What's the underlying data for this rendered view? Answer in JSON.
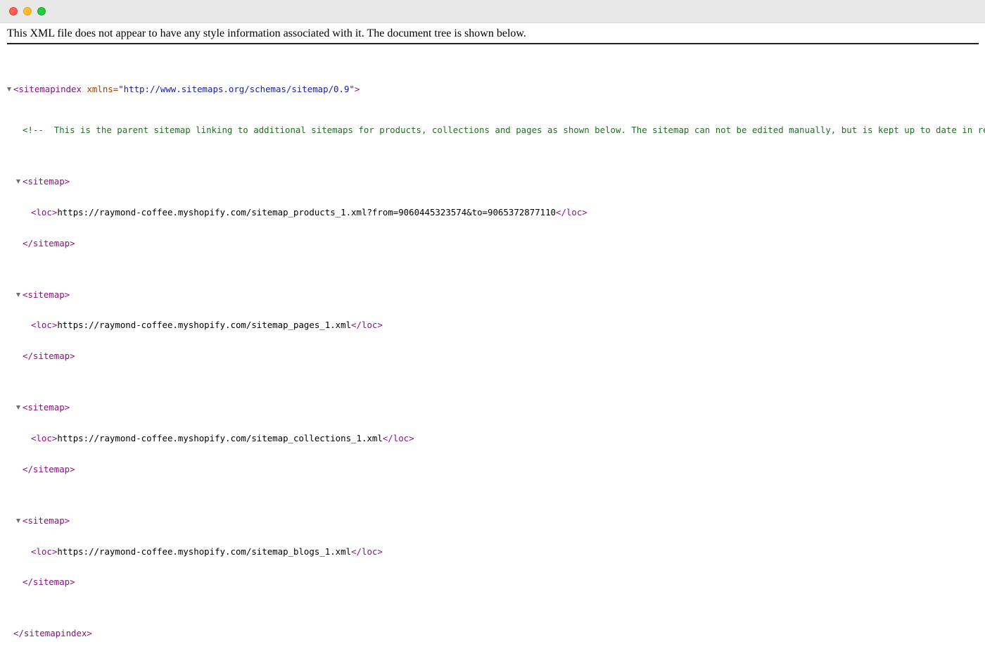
{
  "window": {
    "buttons": [
      "close",
      "minimize",
      "maximize"
    ]
  },
  "info_message": "This XML file does not appear to have any style information associated with it. The document tree is shown below.",
  "xml": {
    "root_open_tag": "<sitemapindex",
    "root_attr_name": " xmlns=",
    "root_attr_value": "\"http://www.sitemaps.org/schemas/sitemap/0.9\"",
    "root_open_end": ">",
    "comment": "<!--  This is the parent sitemap linking to additional sitemaps for products, collections and pages as shown below. The sitemap can not be edited manually, but is kept up to date in real time.  -->",
    "sitemap_open": "<sitemap>",
    "sitemap_close": "</sitemap>",
    "loc_open": "<loc>",
    "loc_close": "</loc>",
    "root_close_tag": "</sitemapindex>",
    "sitemaps": [
      {
        "loc": "https://raymond-coffee.myshopify.com/sitemap_products_1.xml?from=9060445323574&to=9065372877110"
      },
      {
        "loc": "https://raymond-coffee.myshopify.com/sitemap_pages_1.xml"
      },
      {
        "loc": "https://raymond-coffee.myshopify.com/sitemap_collections_1.xml"
      },
      {
        "loc": "https://raymond-coffee.myshopify.com/sitemap_blogs_1.xml"
      }
    ]
  },
  "colors": {
    "tag": "#881280",
    "attr_name": "#994500",
    "attr_value": "#1a1aa6",
    "comment": "#236e25"
  }
}
